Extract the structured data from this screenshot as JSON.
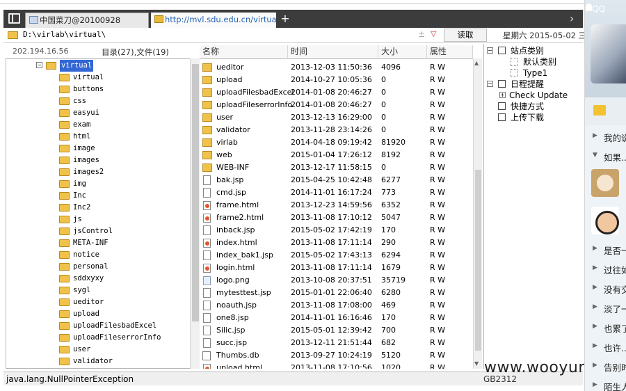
{
  "tabs": [
    {
      "label": "中国菜刀@20100928",
      "active": true
    },
    {
      "label": "http://mvl.sdu.edu.cn/virtual/...",
      "active": false
    }
  ],
  "address": {
    "path": "D:\\virlab\\virtual\\",
    "read_button": "读取",
    "date": "星期六 2015-05-02 三月"
  },
  "ip": "202.194.16.56",
  "dir_count": "目录(27),文件(19)",
  "columns": {
    "name": "名称",
    "time": "时间",
    "size": "大小",
    "attr": "属性"
  },
  "tree": [
    {
      "label": "virtual",
      "selected": true
    },
    {
      "label": "virtual"
    },
    {
      "label": "buttons"
    },
    {
      "label": "css"
    },
    {
      "label": "easyui"
    },
    {
      "label": "exam"
    },
    {
      "label": "html"
    },
    {
      "label": "image"
    },
    {
      "label": "images"
    },
    {
      "label": "images2"
    },
    {
      "label": "img"
    },
    {
      "label": "Inc"
    },
    {
      "label": "Inc2"
    },
    {
      "label": "js"
    },
    {
      "label": "jsControl"
    },
    {
      "label": "META-INF"
    },
    {
      "label": "notice"
    },
    {
      "label": "personal"
    },
    {
      "label": "sddxyxy"
    },
    {
      "label": "sygl"
    },
    {
      "label": "ueditor"
    },
    {
      "label": "upload"
    },
    {
      "label": "uploadFilesbadExcel"
    },
    {
      "label": "uploadFileserrorInfo"
    },
    {
      "label": "user"
    },
    {
      "label": "validator"
    }
  ],
  "files": [
    {
      "name": "ueditor",
      "time": "2013-12-03 11:50:36",
      "size": "4096",
      "attr": "R W",
      "icon": "folder"
    },
    {
      "name": "upload",
      "time": "2014-10-27 10:05:36",
      "size": "0",
      "attr": "R W",
      "icon": "folder"
    },
    {
      "name": "uploadFilesbadExcel",
      "time": "2014-01-08 20:46:27",
      "size": "0",
      "attr": "R W",
      "icon": "folder"
    },
    {
      "name": "uploadFileserrorInfo",
      "time": "2014-01-08 20:46:27",
      "size": "0",
      "attr": "R W",
      "icon": "folder"
    },
    {
      "name": "user",
      "time": "2013-12-13 16:29:00",
      "size": "0",
      "attr": "R W",
      "icon": "folder"
    },
    {
      "name": "validator",
      "time": "2013-11-28 23:14:26",
      "size": "0",
      "attr": "R W",
      "icon": "folder"
    },
    {
      "name": "virlab",
      "time": "2014-04-18 09:19:42",
      "size": "81920",
      "attr": "R W",
      "icon": "folder"
    },
    {
      "name": "web",
      "time": "2015-01-04 17:26:12",
      "size": "8192",
      "attr": "R W",
      "icon": "folder"
    },
    {
      "name": "WEB-INF",
      "time": "2013-12-17 11:58:15",
      "size": "0",
      "attr": "R W",
      "icon": "folder"
    },
    {
      "name": "bak.jsp",
      "time": "2015-04-25 10:42:48",
      "size": "6277",
      "attr": "R W",
      "icon": "doc"
    },
    {
      "name": "cmd.jsp",
      "time": "2014-11-01 16:17:24",
      "size": "773",
      "attr": "R W",
      "icon": "doc"
    },
    {
      "name": "frame.html",
      "time": "2013-12-23 14:59:56",
      "size": "6352",
      "attr": "R W",
      "icon": "html"
    },
    {
      "name": "frame2.html",
      "time": "2013-11-08 17:10:12",
      "size": "5047",
      "attr": "R W",
      "icon": "html"
    },
    {
      "name": "inback.jsp",
      "time": "2015-05-02 17:42:19",
      "size": "170",
      "attr": "R W",
      "icon": "doc"
    },
    {
      "name": "index.html",
      "time": "2013-11-08 17:11:14",
      "size": "290",
      "attr": "R W",
      "icon": "html"
    },
    {
      "name": "index_bak1.jsp",
      "time": "2015-05-02 17:43:13",
      "size": "6294",
      "attr": "R W",
      "icon": "doc"
    },
    {
      "name": "login.html",
      "time": "2013-11-08 17:11:14",
      "size": "1679",
      "attr": "R W",
      "icon": "html"
    },
    {
      "name": "logo.png",
      "time": "2013-10-08 20:37:51",
      "size": "35719",
      "attr": "R W",
      "icon": "img"
    },
    {
      "name": "mytesttest.jsp",
      "time": "2015-01-01 22:06:40",
      "size": "6280",
      "attr": "R W",
      "icon": "doc"
    },
    {
      "name": "noauth.jsp",
      "time": "2013-11-08 17:08:00",
      "size": "469",
      "attr": "R W",
      "icon": "doc"
    },
    {
      "name": "one8.jsp",
      "time": "2014-11-01 16:16:46",
      "size": "170",
      "attr": "R W",
      "icon": "doc"
    },
    {
      "name": "Silic.jsp",
      "time": "2015-05-01 12:39:42",
      "size": "700",
      "attr": "R W",
      "icon": "doc"
    },
    {
      "name": "succ.jsp",
      "time": "2013-12-11 21:51:44",
      "size": "682",
      "attr": "R W",
      "icon": "doc"
    },
    {
      "name": "Thumbs.db",
      "time": "2013-09-27 10:24:19",
      "size": "5120",
      "attr": "R W",
      "icon": "db"
    },
    {
      "name": "upload.html",
      "time": "2013-11-08 17:10:56",
      "size": "1020",
      "attr": "R W",
      "icon": "html"
    }
  ],
  "right_panel": [
    {
      "label": "站点类别",
      "level": 0,
      "type": "expand"
    },
    {
      "label": "默认类别",
      "level": 1,
      "type": "page"
    },
    {
      "label": "Type1",
      "level": 1,
      "type": "page"
    },
    {
      "label": "日程提醒",
      "level": 0,
      "type": "expand"
    },
    {
      "label": "Check Update",
      "level": 1,
      "type": "plus"
    },
    {
      "label": "快捷方式",
      "level": 0,
      "type": "item"
    },
    {
      "label": "上传下载",
      "level": 0,
      "type": "item"
    }
  ],
  "status": {
    "error": "java.lang.NullPointerException",
    "encoding": "GB2312"
  },
  "watermark": "www.wooyun.org",
  "qq": {
    "label": "QQ",
    "items": [
      "我的说",
      "如果...",
      "是否一",
      "过往如",
      "没有交",
      "淡了一",
      "也累了",
      "也许...",
      "告别时",
      "陌生人"
    ]
  }
}
